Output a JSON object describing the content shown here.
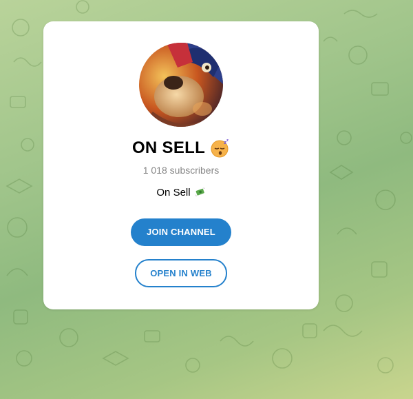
{
  "channel": {
    "title": "ON SELL",
    "title_emoji": "sleeping-face-icon",
    "subscribers": "1 018 subscribers",
    "description": "On Sell",
    "description_emoji": "money-with-wings-icon"
  },
  "actions": {
    "join_label": "JOIN CHANNEL",
    "web_label": "OPEN IN WEB"
  },
  "colors": {
    "accent": "#2481cc",
    "muted_text": "#868686",
    "card": "#ffffff"
  }
}
